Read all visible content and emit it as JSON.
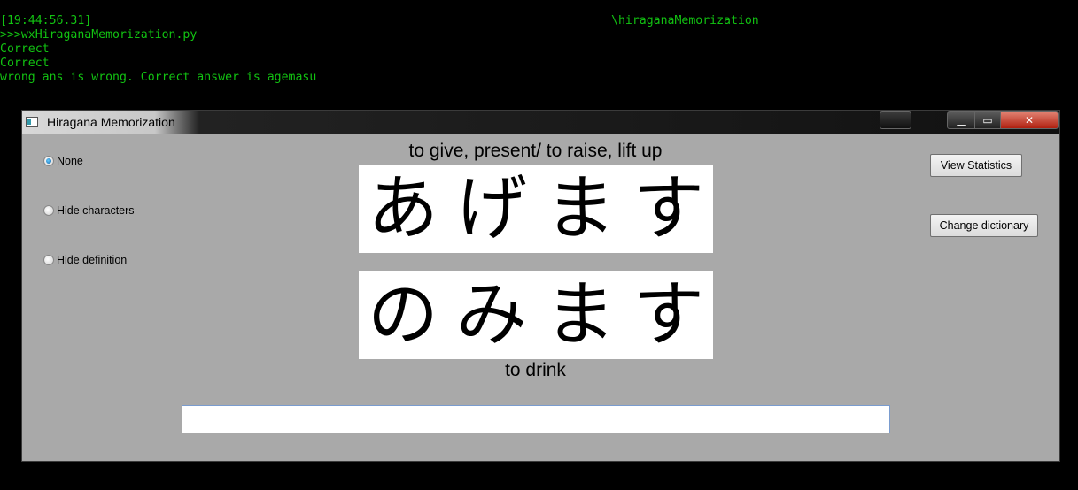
{
  "console": {
    "lines": [
      "[19:44:56.31]",
      ">>>wxHiraganaMemorization.py",
      "Correct",
      "Correct",
      "wrong ans is wrong. Correct answer is agemasu"
    ],
    "path": "\\hiraganaMemorization",
    "text_color": "#12c212"
  },
  "window": {
    "title": "Hiragana Memorization",
    "controls": {
      "minimize": "▁",
      "maximize": "▭",
      "close": "✕"
    }
  },
  "options": [
    {
      "label": "None",
      "checked": true
    },
    {
      "label": "Hide characters",
      "checked": false
    },
    {
      "label": "Hide definition",
      "checked": false
    }
  ],
  "card1": {
    "definition": "to give, present/ to raise, lift up",
    "kana": [
      "あ",
      "げ",
      "ま",
      "す"
    ]
  },
  "card2": {
    "definition": "to drink",
    "kana": [
      "の",
      "み",
      "ま",
      "す"
    ]
  },
  "buttons": {
    "view_statistics": "View Statistics",
    "change_dictionary": "Change dictionary"
  },
  "answer": {
    "value": "",
    "placeholder": ""
  }
}
